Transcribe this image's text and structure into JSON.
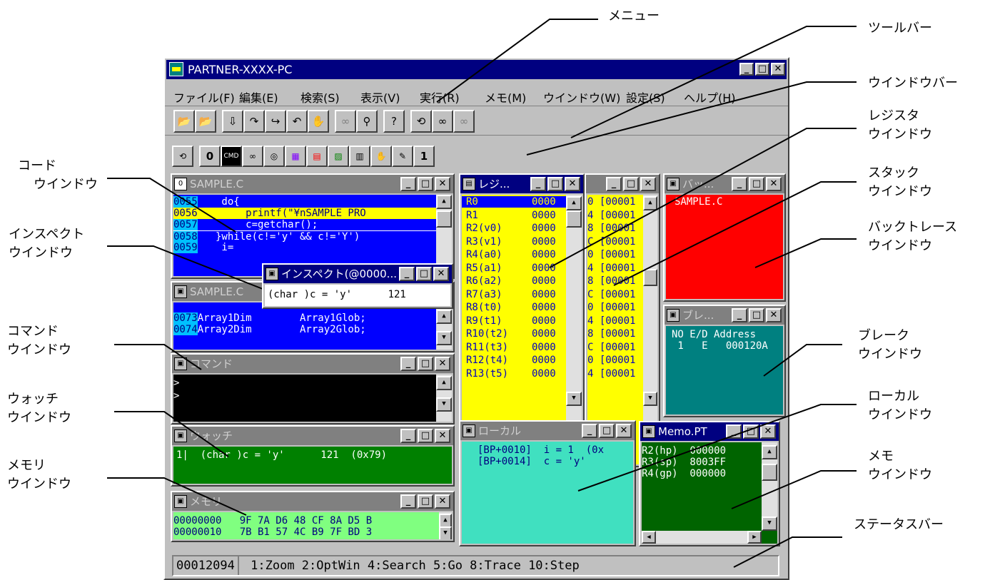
{
  "callouts": {
    "menu": "メニュー",
    "toolbar": "ツールバー",
    "windowbar": "ウインドウバー",
    "register": [
      "レジスタ",
      "ウインドウ"
    ],
    "stack": [
      "スタック",
      "ウインドウ"
    ],
    "backtrace": [
      "バックトレース",
      "ウインドウ"
    ],
    "code": [
      "コード",
      "ウインドウ"
    ],
    "inspect": [
      "インスペクト",
      "ウインドウ"
    ],
    "command": [
      "コマンド",
      "ウインドウ"
    ],
    "watch": [
      "ウォッチ",
      "ウインドウ"
    ],
    "memory": [
      "メモリ",
      "ウインドウ"
    ],
    "break": [
      "ブレーク",
      "ウインドウ"
    ],
    "local": [
      "ローカル",
      "ウインドウ"
    ],
    "memo": [
      "メモ",
      "ウインドウ"
    ],
    "statusbar": "ステータスバー"
  },
  "app": {
    "title": "PARTNER-XXXX-PC",
    "icon": "partner-app-icon",
    "menu": [
      "ファイル(F)",
      "編集(E)",
      "検索(S)",
      "表示(V)",
      "実行(R)",
      "メモ(M)",
      "ウインドウ(W)",
      "設定(S)",
      "ヘルプ(H)"
    ]
  },
  "toolbar": {
    "icons": [
      "open-folder-icon",
      "open-folder-arrow-icon",
      "step-into-icon",
      "step-over-icon",
      "step-return-icon",
      "step-back-icon",
      "stop-hand-icon",
      "glasses-icon",
      "magnifier-icon",
      "help-window-icon",
      "refresh-icon",
      "binoculars-icon",
      "binoculars-disabled-icon"
    ]
  },
  "windowbar": {
    "items": [
      "refresh",
      "0",
      "CMD",
      "glasses",
      "disk",
      "memory",
      "stack",
      "image",
      "chip",
      "hand",
      "pencil",
      "1"
    ]
  },
  "code_window": {
    "title": "SAMPLE.C",
    "lines": [
      {
        "no": "0055",
        "text": "    do{"
      },
      {
        "no": "0056",
        "text": "        printf(\"¥nSAMPLE PRO"
      },
      {
        "no": "0057",
        "text": "        c=getchar();"
      },
      {
        "no": "0058",
        "text": "   }while(c!='y' && c!='Y')"
      },
      {
        "no": "0059",
        "text": "    i="
      }
    ]
  },
  "inspect_window": {
    "title": "インスペクト(@0000...",
    "content": "(char )c = 'y'      121"
  },
  "code_window2": {
    "title": "SAMPLE.C",
    "lines": [
      {
        "no": "0073",
        "text": "Array1Dim        Array1Glob;"
      },
      {
        "no": "0074",
        "text": "Array2Dim        Array2Glob;"
      }
    ]
  },
  "command_window": {
    "title": "コマンド",
    "lines": [
      ">",
      ">"
    ]
  },
  "watch_window": {
    "title": "ウォッチ",
    "line": "1|  (char )c = 'y'      121  (0x79)"
  },
  "memory_window": {
    "title": "メモリ",
    "lines": [
      "00000000   9F 7A D6 48 CF 8A D5 B",
      "00000010   7B B1 57 4C B9 7F BD 3"
    ]
  },
  "register_window": {
    "title": "レジ...",
    "names": [
      "R0",
      "R1",
      "R2(v0)",
      "R3(v1)",
      "R4(a0)",
      "R5(a1)",
      "R6(a2)",
      "R7(a3)",
      "R8(t0)",
      "R9(t1)",
      "R10(t2)",
      "R11(t3)",
      "R12(t4)",
      "R13(t5)"
    ],
    "values": [
      "0000",
      "0000",
      "0000",
      "0000",
      "0000",
      "0000",
      "0000",
      "0000",
      "0000",
      "0000",
      "0000",
      "0000",
      "0000",
      "0000"
    ]
  },
  "stack_window": {
    "lines": [
      "0 [00001",
      "4 [00001",
      "8 [00001",
      "C [00001",
      "0 [00001",
      "4 [00001",
      "8 [00001",
      "C [00001",
      "0 [00001",
      "4 [00001",
      "8 [00001",
      "C [00001",
      "0 [00001",
      "4 [00001"
    ]
  },
  "backtrace_window": {
    "title": "バッ...",
    "line": "SAMPLE.C          :"
  },
  "break_window": {
    "title": "ブレ...",
    "header": "NO E/D Address",
    "row": " 1   E   000120A"
  },
  "local_window": {
    "title": "ローカル",
    "lines": [
      "[BP+0010]  i = 1  (0x",
      "[BP+0014]  c = 'y'"
    ]
  },
  "memo_window": {
    "title": "Memo.PT",
    "lines": [
      "R2(hp)  000000",
      "R3(sp)  8003FF",
      "R4(gp)  000000"
    ]
  },
  "statusbar": {
    "address": "00012094",
    "keys": "1:Zoom 2:OptWin 4:Search 5:Go 8:Trace 10:Step"
  },
  "colors": {
    "titlebar_active": "#000080",
    "code_bg": "#0000ff",
    "code_highlight": "#ffff00",
    "register_bg": "#ffff00",
    "backtrace_bg": "#ff0000",
    "break_bg": "#008080",
    "command_bg": "#000000",
    "watch_bg": "#008000",
    "memory_bg": "#80ff80",
    "local_bg": "#40e0c0",
    "memo_bg": "#006400"
  }
}
